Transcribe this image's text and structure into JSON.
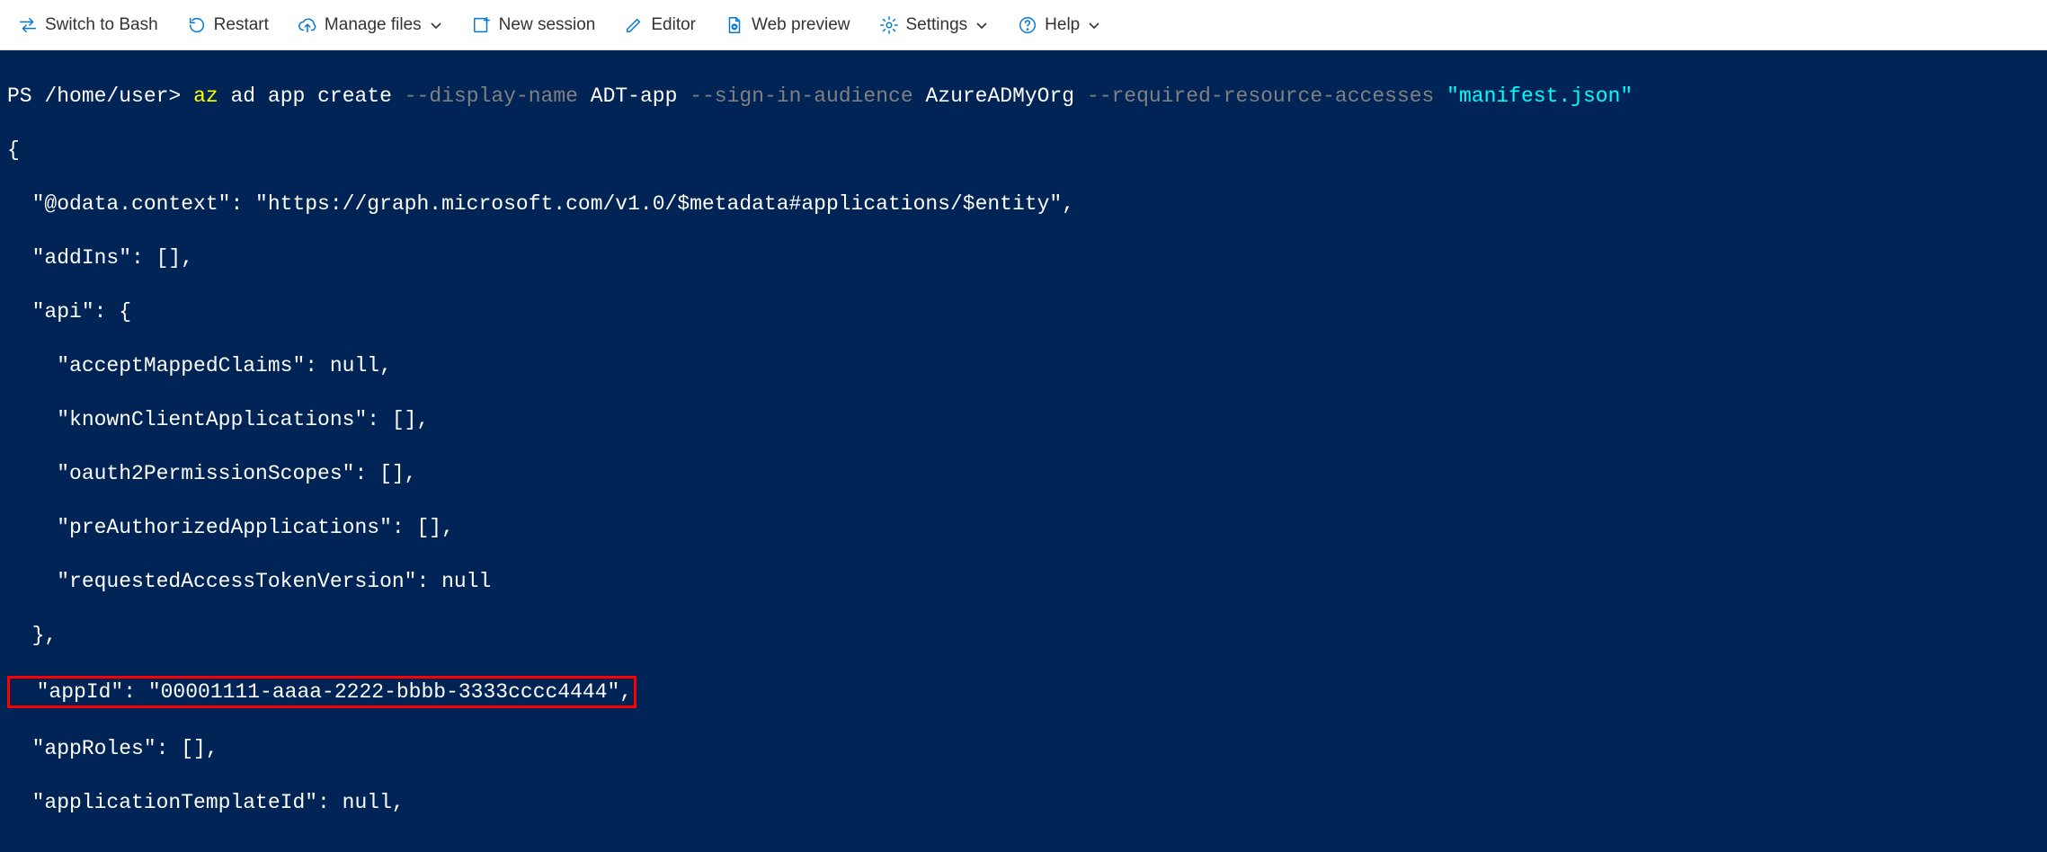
{
  "toolbar": {
    "switch_to_bash": "Switch to Bash",
    "restart": "Restart",
    "manage_files": "Manage files",
    "new_session": "New session",
    "editor": "Editor",
    "web_preview": "Web preview",
    "settings": "Settings",
    "help": "Help"
  },
  "terminal": {
    "prompt_prefix": "PS ",
    "prompt_path": "/home/user",
    "prompt_suffix": ">",
    "cmd_az": "az",
    "cmd_ad_app_create": " ad app create ",
    "opt_display_name": "--display-name",
    "val_display_name": " ADT-app ",
    "opt_sign_in_audience": "--sign-in-audience",
    "val_sign_in_audience": " AzureADMyOrg ",
    "opt_required_resource": "--required-resource-accesses",
    "val_manifest": " \"manifest.json\"",
    "out_line1": "{",
    "out_line2": "  \"@odata.context\": \"https://graph.microsoft.com/v1.0/$metadata#applications/$entity\",",
    "out_line3": "  \"addIns\": [],",
    "out_line4": "  \"api\": {",
    "out_line5": "    \"acceptMappedClaims\": null,",
    "out_line6": "    \"knownClientApplications\": [],",
    "out_line7": "    \"oauth2PermissionScopes\": [],",
    "out_line8": "    \"preAuthorizedApplications\": [],",
    "out_line9": "    \"requestedAccessTokenVersion\": null",
    "out_line10": "  },",
    "out_app_id": "  \"appId\": \"00001111-aaaa-2222-bbbb-3333cccc4444\",",
    "out_line12": "  \"appRoles\": [],",
    "out_line13": "  \"applicationTemplateId\": null,"
  }
}
